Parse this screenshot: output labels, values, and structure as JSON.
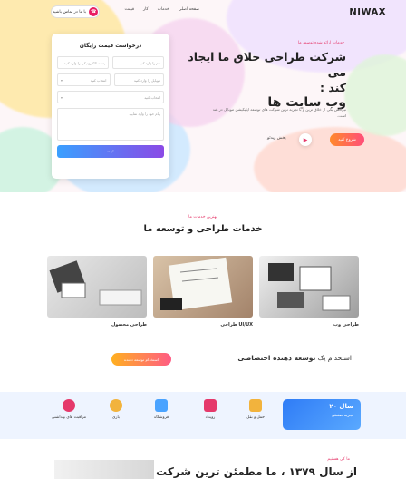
{
  "nav": {
    "logo": "NIWAX",
    "links": [
      "صفحه اصلی",
      "خدمات",
      "کار",
      "قیمت"
    ],
    "contact_label": "با ما در تماس باشید"
  },
  "hero": {
    "eyebrow": "خدمات ارائه شده توسط ما",
    "title_line1": "شرکت طراحی خلاق ما ایجاد می",
    "title_line2": "کند :",
    "title_line3": "وب سایت ها",
    "description": "نیواکس یکی از خلاق ترین و با تجربه ترین شرکت های توسعه اپلیکیشن موبایل در هند است.",
    "cta_label": "شروع کنید",
    "play_label": "پخش ویدئو"
  },
  "form": {
    "title": "درخواست قیمت رایگان",
    "name_placeholder": "نام را وارد کنید",
    "email_placeholder": "پست الکترونیکی را وارد کنید",
    "phone_placeholder": "موبایل را وارد کنید",
    "service_placeholder": "انتخاب کنید",
    "budget_placeholder": "انتخاب کنید",
    "message_placeholder": "پیام خود را وارد نمایید",
    "submit_label": "ثبت"
  },
  "services": {
    "eyebrow": "بهترین خدمات ما",
    "title": "خدمات طراحی و توسعه ما",
    "items": [
      {
        "label": "طراحی وب"
      },
      {
        "label": "طراحی UI/UX"
      },
      {
        "label": "طراحی محصول"
      }
    ]
  },
  "hire": {
    "prefix": "استخدام یک",
    "bold": "توسعه دهنده اختصاصی",
    "button_label": "استخدام توسعه دهنده"
  },
  "stats": {
    "experience_number": "۲۰ سال",
    "experience_label": "تجربه صنعتی",
    "industries": [
      {
        "label": "حمل و نقل",
        "icon": "truck-icon",
        "color": "#f2b33d"
      },
      {
        "label": "رویداد",
        "icon": "calendar-icon",
        "color": "#e5396b"
      },
      {
        "label": "فروشگاه",
        "icon": "shop-icon",
        "color": "#4aa3ff"
      },
      {
        "label": "بازی",
        "icon": "gamepad-icon",
        "color": "#f2b33d"
      },
      {
        "label": "مراقبت های بهداشتی",
        "icon": "heart-care-icon",
        "color": "#e5396b"
      }
    ]
  },
  "about": {
    "eyebrow": "ما کی هستیم",
    "title": "از سال ۱۳۷۹ ، ما مطمئن ترین شرکت"
  },
  "colors": {
    "accent": "#e5396b",
    "primary_gradient_start": "#3aa0ff",
    "primary_gradient_end": "#8a4ae6"
  }
}
